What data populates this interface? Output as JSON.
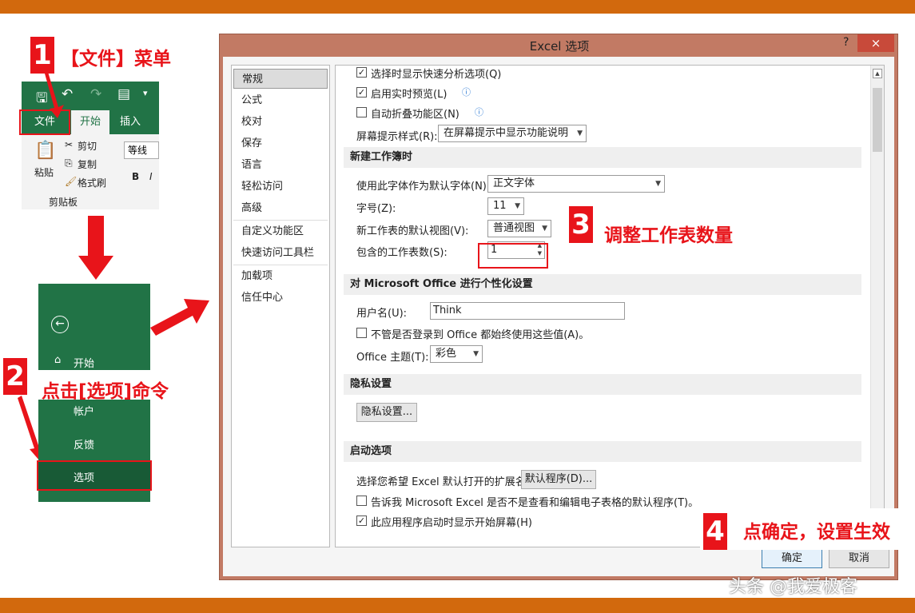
{
  "annotations": {
    "step1": {
      "num": "1",
      "text": "【文件】菜单"
    },
    "step2": {
      "num": "2",
      "text": "点击[选项]命令"
    },
    "step3": {
      "num": "3",
      "text": "调整工作表数量"
    },
    "step4": {
      "num": "4",
      "text": "点确定，设置生效"
    }
  },
  "ribbon": {
    "tabs": [
      "文件",
      "开始",
      "插入"
    ],
    "paste_label": "粘贴",
    "cut_label": "剪切",
    "copy_label": "复制",
    "format_painter_label": "格式刷",
    "clipboard_group": "剪贴板",
    "font_name": "等线",
    "bold": "B",
    "italic": "I"
  },
  "backstage": {
    "home": "开始",
    "account": "帐户",
    "feedback": "反馈",
    "options": "选项"
  },
  "dialog": {
    "title": "Excel 选项",
    "help": "?",
    "close": "×",
    "nav": [
      "常规",
      "公式",
      "校对",
      "保存",
      "语言",
      "轻松访问",
      "高级",
      "自定义功能区",
      "快速访问工具栏",
      "加载项",
      "信任中心"
    ],
    "general": {
      "quick_analysis": "选择时显示快速分析选项(Q)",
      "live_preview": "启用实时预览(L)",
      "collapse_ribbon": "自动折叠功能区(N)",
      "screentip_label": "屏幕提示样式(R):",
      "screentip_value": "在屏幕提示中显示功能说明"
    },
    "new_workbook": {
      "header": "新建工作簿时",
      "font_label": "使用此字体作为默认字体(N):",
      "font_value": "正文字体",
      "size_label": "字号(Z):",
      "size_value": "11",
      "view_label": "新工作表的默认视图(V):",
      "view_value": "普通视图",
      "sheets_label": "包含的工作表数(S):",
      "sheets_value": "1"
    },
    "personalize": {
      "header": "对 Microsoft Office 进行个性化设置",
      "username_label": "用户名(U):",
      "username_value": "Think",
      "always_use": "不管是否登录到 Office 都始终使用这些值(A)。",
      "theme_label": "Office 主题(T):",
      "theme_value": "彩色"
    },
    "privacy": {
      "header": "隐私设置",
      "button": "隐私设置..."
    },
    "startup": {
      "header": "启动选项",
      "ext_label": "选择您希望 Excel 默认打开的扩展名:",
      "ext_button": "默认程序(D)...",
      "tell_me": "告诉我 Microsoft Excel 是否不是查看和编辑电子表格的默认程序(T)。",
      "show_start": "此应用程序启动时显示开始屏幕(H)"
    },
    "ok": "确定",
    "cancel": "取消"
  },
  "watermark": "头条 @我爱极客",
  "colors": {
    "orange_bar": "#d2690d",
    "excel_green": "#217346",
    "annotation_red": "#e8141a"
  }
}
